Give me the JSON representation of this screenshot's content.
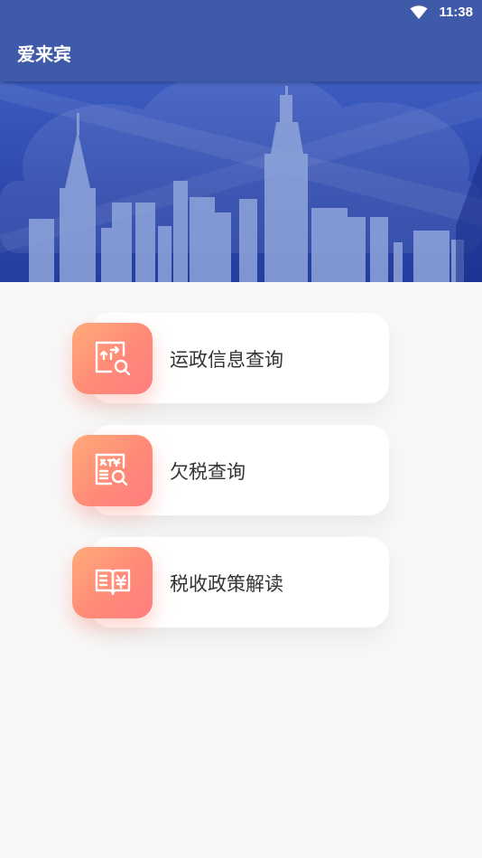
{
  "status_bar": {
    "time": "11:38",
    "icons": [
      "wifi-icon"
    ]
  },
  "app_bar": {
    "title": "爱来宾"
  },
  "banner": {
    "image": "city-skyline-illustration",
    "colors": {
      "top": "#3c5cc0",
      "bottom": "#243e9f"
    }
  },
  "menu": {
    "items": [
      {
        "label": "运政信息查询",
        "icon": "route-search-icon"
      },
      {
        "label": "欠税查询",
        "icon": "tax-arrears-search-icon"
      },
      {
        "label": "税收政策解读",
        "icon": "tax-policy-book-icon"
      }
    ]
  },
  "colors": {
    "accent": "#3f5aa8",
    "badge_gradient": [
      "#ffab7a",
      "#ff7e7e"
    ],
    "background": "#f8f8f8"
  }
}
